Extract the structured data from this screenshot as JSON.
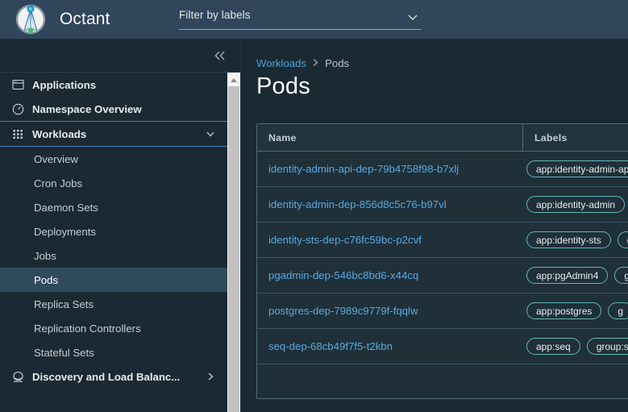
{
  "header": {
    "brand_title": "Octant",
    "logo_icon": "octant-logo-icon",
    "filter": {
      "label": "Filter by labels",
      "placeholder": "Filter by labels",
      "caret_icon": "chevron-down-icon"
    }
  },
  "sidebar": {
    "collapse_icon": "double-chevron-left-icon",
    "scrollbar": {
      "up_icon": "scroll-up-arrow-icon"
    },
    "items": [
      {
        "label": "Applications",
        "icon": "application-window-icon",
        "type": "top"
      },
      {
        "label": "Namespace Overview",
        "icon": "gauge-icon",
        "type": "top"
      },
      {
        "label": "Workloads",
        "icon": "grid-dots-icon",
        "type": "top",
        "expanded": true,
        "arrow_icon": "chevron-down-icon"
      },
      {
        "label": "Overview",
        "type": "sub"
      },
      {
        "label": "Cron Jobs",
        "type": "sub"
      },
      {
        "label": "Daemon Sets",
        "type": "sub"
      },
      {
        "label": "Deployments",
        "type": "sub"
      },
      {
        "label": "Jobs",
        "type": "sub"
      },
      {
        "label": "Pods",
        "type": "sub",
        "active": true
      },
      {
        "label": "Replica Sets",
        "type": "sub"
      },
      {
        "label": "Replication Controllers",
        "type": "sub"
      },
      {
        "label": "Stateful Sets",
        "type": "sub"
      },
      {
        "label": "Discovery and Load Balanc...",
        "icon": "discovery-icon",
        "type": "top",
        "arrow_icon": "chevron-right-icon"
      }
    ]
  },
  "main": {
    "breadcrumb": {
      "parent": "Workloads",
      "separator": "›",
      "current": "Pods"
    },
    "page_title": "Pods",
    "table": {
      "columns": [
        "Name",
        "Labels"
      ],
      "rows": [
        {
          "name": "identity-admin-api-dep-79b4758f98-b7xlj",
          "labels": [
            "app:identity-admin-api"
          ]
        },
        {
          "name": "identity-admin-dep-856d8c5c76-b97vl",
          "labels": [
            "app:identity-admin"
          ]
        },
        {
          "name": "identity-sts-dep-c76fc59bc-p2cvf",
          "labels": [
            "app:identity-sts",
            "g"
          ]
        },
        {
          "name": "pgadmin-dep-546bc8bd6-x44cq",
          "labels": [
            "app:pgAdmin4",
            "g"
          ]
        },
        {
          "name": "postgres-dep-7989c9779f-fqqlw",
          "labels": [
            "app:postgres",
            "g"
          ]
        },
        {
          "name": "seq-dep-68cb49f7f5-t2kbn",
          "labels": [
            "app:seq",
            "group:s"
          ]
        }
      ]
    }
  },
  "colors": {
    "header_bg": "#31465a",
    "page_bg": "#1b2a32",
    "link": "#4aa4df",
    "chip_border": "#63b7bd",
    "active_nav": "#2e4a5d",
    "expanded_border": "#4b7ab5"
  }
}
